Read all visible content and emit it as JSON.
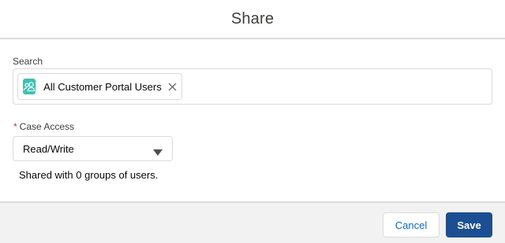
{
  "modal": {
    "title": "Share"
  },
  "search": {
    "label": "Search",
    "selected_pill": {
      "label": "All Customer Portal Users",
      "icon": "users-group-icon"
    }
  },
  "case_access": {
    "required_marker": "*",
    "label": "Case Access",
    "selected_value": "Read/Write"
  },
  "shared_summary": "Shared with 0 groups of users.",
  "footer": {
    "cancel_label": "Cancel",
    "save_label": "Save"
  },
  "colors": {
    "brand_button": "#1a4f93",
    "link_blue": "#0070d2",
    "pill_icon_bg": "#3cc2b3",
    "required_red": "#c23934",
    "footer_bg": "#f3f2f2"
  }
}
